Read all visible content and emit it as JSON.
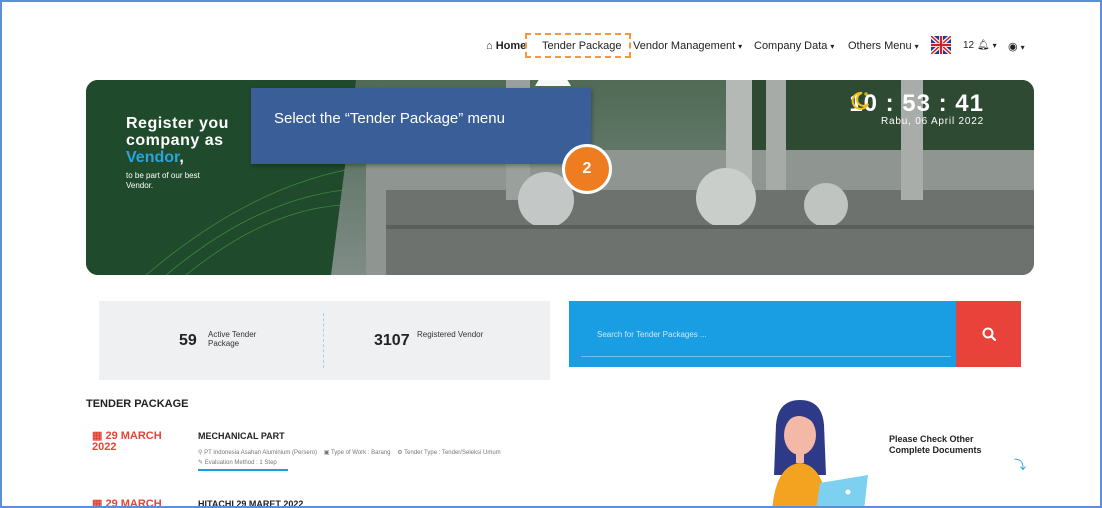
{
  "nav": {
    "home": "Home",
    "tender_package": "Tender Package",
    "vendor_management": "Vendor Management",
    "company_data": "Company Data",
    "others_menu": "Others Menu",
    "notif_count": "12"
  },
  "hero": {
    "title_line1": "Register you",
    "title_line2": "company as",
    "vendor_word": "Vendor",
    "vendor_comma": ",",
    "sub_line1": "to be part of our best",
    "sub_line2": "Vendor."
  },
  "clock": {
    "time": "10 : 53 : 41",
    "date": "Rabu, 06 April 2022"
  },
  "tooltip": {
    "text": "Select the “Tender Package” menu",
    "step": "2"
  },
  "stats": {
    "active_count": "59",
    "active_label_1": "Active Tender",
    "active_label_2": "Package",
    "vendor_count": "3107",
    "vendor_label": "Registered Vendor"
  },
  "search": {
    "placeholder": "Search for Tender Packages ..."
  },
  "section_title": "TENDER PACKAGE",
  "tenders": [
    {
      "date_line1": "29 MARCH",
      "date_line2": "2022",
      "title": "MECHANICAL PART",
      "company": "PT Indonesia Asahan Aluminium (Persero)",
      "work_type": "Type of Work : Barang",
      "tender_type": "Tender Type : Tender/Seleksi Umum",
      "evaluation": "Evaluation Method : 1 Step"
    },
    {
      "date_line1": "29 MARCH",
      "title": "HITACHI 29 MARET 2022"
    }
  ],
  "promo": {
    "line1": "Please Check Other",
    "line2": "Complete Documents"
  },
  "colors": {
    "accent_blue": "#1a9ee3",
    "tooltip_blue": "#3a5f98",
    "step_orange": "#ee7d22",
    "date_red": "#e44534",
    "search_btn_red": "#e9423b"
  }
}
